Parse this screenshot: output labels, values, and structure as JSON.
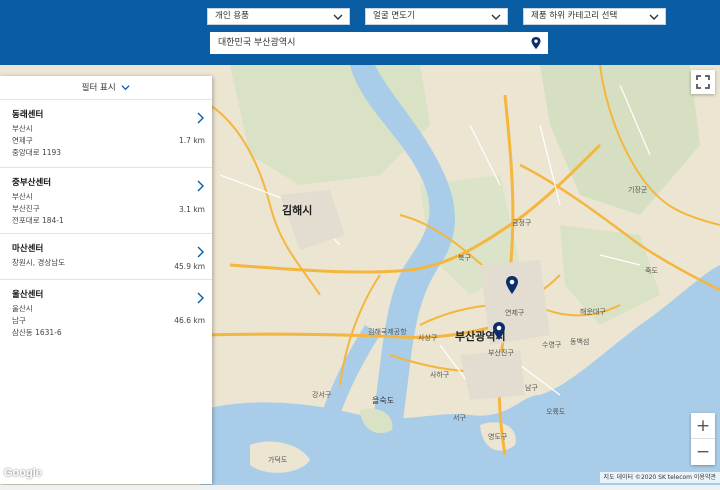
{
  "header": {
    "select_category": "개인 용품",
    "select_product": "얼굴 면도기",
    "select_subcategory": "제품 하위 카테고리 선택",
    "location_value": "대한민국 부산광역시"
  },
  "filter": {
    "label": "필터 표시"
  },
  "centers": [
    {
      "name": "동래센터",
      "lines": [
        "부산시",
        "연제구",
        "중앙대로 1193"
      ],
      "distance": "1.7 km"
    },
    {
      "name": "중부산센터",
      "lines": [
        "부산시",
        "부산진구",
        "전포대로 184-1"
      ],
      "distance": "3.1 km"
    },
    {
      "name": "마산센터",
      "lines": [
        "창원시, 경상남도"
      ],
      "distance": "45.9 km"
    },
    {
      "name": "울산센터",
      "lines": [
        "울산시",
        "남구",
        "삼산동 1631-6"
      ],
      "distance": "46.6 km"
    }
  ],
  "map": {
    "labels": {
      "gimhae": "김해시",
      "busan": "부산광역시",
      "gijang": "기장군",
      "geumjeong": "금정구",
      "buk": "북구",
      "yeonje": "연제구",
      "haeundae": "해운대구",
      "suyeong": "수영구",
      "dongbaek": "동백섬",
      "airport": "김해국제공항",
      "sasang": "사상구",
      "busanjin": "부산진구",
      "nam": "남구",
      "saha": "사하구",
      "eulsukdo": "을숙도",
      "seo": "서구",
      "yeongdo": "영도구",
      "oryukdo": "오륙도",
      "gadeokdo": "가덕도",
      "jukdo": "죽도",
      "gangseo": "강서구"
    },
    "zoom_in": "+",
    "zoom_out": "−",
    "attribution": "지도 데이터 ©2020 SK telecom   이용약관",
    "google_logo": "Google"
  },
  "colors": {
    "header_bg": "#0a5ca3",
    "marker": "#0b2d6b",
    "road": "#f4b63f",
    "water": "#a9cde9"
  }
}
